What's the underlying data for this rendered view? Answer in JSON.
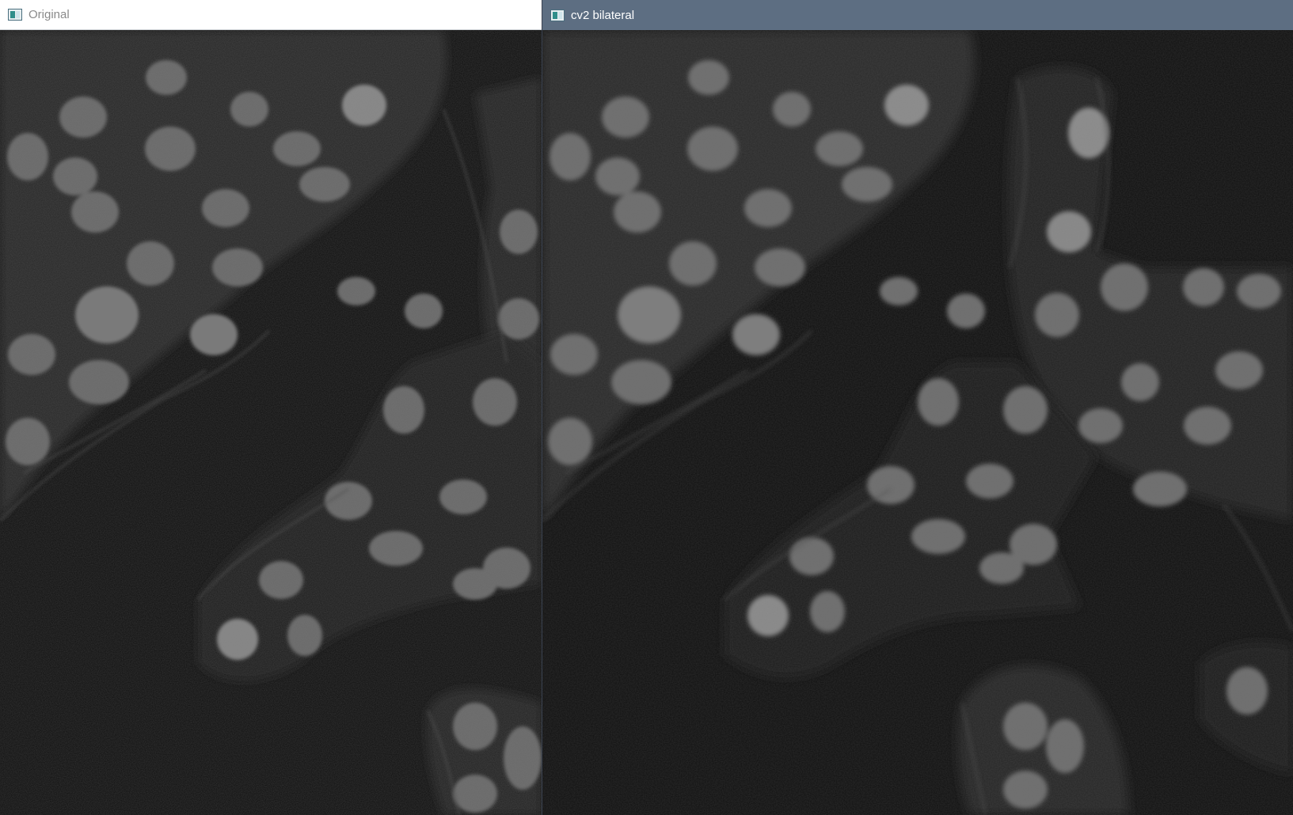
{
  "windows": [
    {
      "title": "Original",
      "icon": "opencv-window-icon",
      "active": false,
      "image": "fluorescence-micrograph-original"
    },
    {
      "title": "cv2 bilateral",
      "icon": "opencv-window-icon",
      "active": true,
      "image": "fluorescence-micrograph-bilateral-filtered"
    }
  ],
  "colors": {
    "active_titlebar": "#5d6e82",
    "inactive_titlebar": "#ffffff",
    "image_background": "#0d0d0d"
  }
}
